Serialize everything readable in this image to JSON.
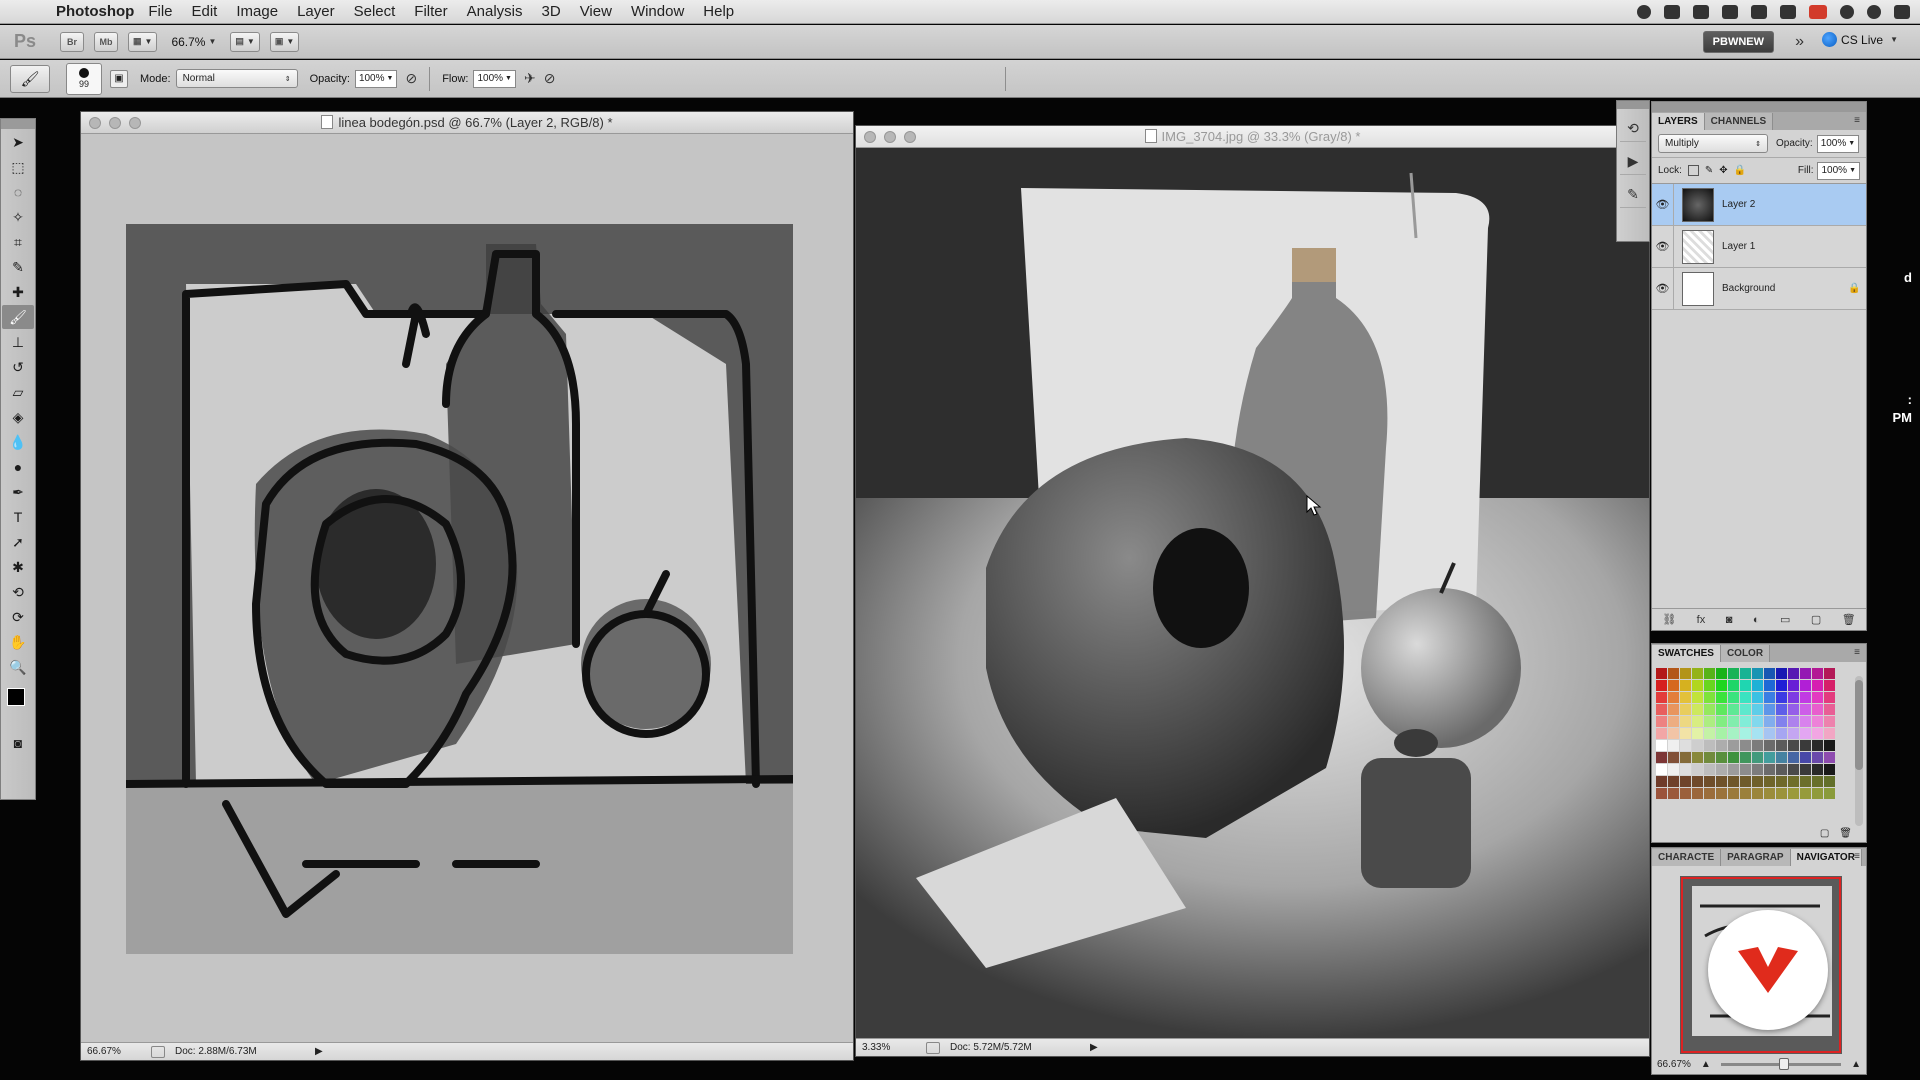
{
  "menubar": {
    "app_name": "Photoshop",
    "items": [
      "File",
      "Edit",
      "Image",
      "Layer",
      "Select",
      "Filter",
      "Analysis",
      "3D",
      "View",
      "Window",
      "Help"
    ]
  },
  "appbar": {
    "logo": "Ps",
    "bridge_label": "Br",
    "minibridge_label": "Mb",
    "zoom": "66.7%",
    "workspace": "PBWNEW",
    "cs_live": "CS Live"
  },
  "options": {
    "brush_size": "99",
    "mode_label": "Mode:",
    "mode_value": "Normal",
    "opacity_label": "Opacity:",
    "opacity_value": "100%",
    "flow_label": "Flow:",
    "flow_value": "100%"
  },
  "doc1": {
    "title": "linea bodegón.psd @ 66.7% (Layer 2, RGB/8) *",
    "zoom": "66.67%",
    "doc_info": "Doc: 2.88M/6.73M"
  },
  "doc2": {
    "title": "IMG_3704.jpg @ 33.3% (Gray/8) *",
    "zoom": "3.33%",
    "doc_info": "Doc: 5.72M/5.72M"
  },
  "layers_panel": {
    "tabs": [
      "LAYERS",
      "CHANNELS"
    ],
    "blend_mode": "Multiply",
    "opacity_label": "Opacity:",
    "opacity_value": "100%",
    "lock_label": "Lock:",
    "fill_label": "Fill:",
    "fill_value": "100%",
    "layers": [
      {
        "name": "Layer 2",
        "selected": true
      },
      {
        "name": "Layer 1",
        "selected": false
      },
      {
        "name": "Background",
        "selected": false,
        "locked": true
      }
    ]
  },
  "swatches_panel": {
    "tabs": [
      "SWATCHES",
      "COLOR"
    ]
  },
  "navigator_panel": {
    "tabs": [
      "CHARACTE",
      "PARAGRAP",
      "NAVIGATOR"
    ],
    "zoom": "66.67%"
  },
  "side_text": {
    "d": "d",
    "colon": ":",
    "pm": "PM"
  },
  "colors": {
    "selection": "#a9cbf2",
    "panel_bg": "#d3d3d3",
    "brand_red": "#e02b1c"
  }
}
